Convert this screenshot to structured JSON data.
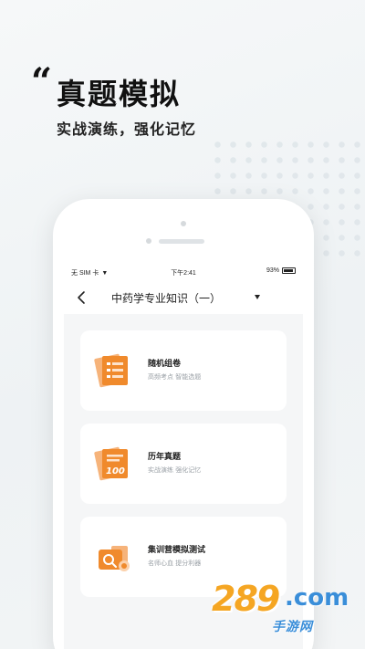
{
  "promo": {
    "quote_mark": "“",
    "headline": "真题模拟",
    "subheadline": "实战演练，强化记忆"
  },
  "status_bar": {
    "carrier": "无 SIM 卡",
    "time": "下午2:41",
    "battery": "93%"
  },
  "nav": {
    "back_icon": "chevron-left-icon",
    "title": "中药学专业知识（一）",
    "dropdown_icon": "caret-down-icon"
  },
  "cards": [
    {
      "title": "随机组卷",
      "subtitle": "高频考点 智能选题",
      "icon": "paper-list-icon"
    },
    {
      "title": "历年真题",
      "subtitle": "实战演练 强化记忆",
      "icon": "score-100-paper-icon"
    },
    {
      "title": "集训营模拟测试",
      "subtitle": "名师心血 提分利器",
      "icon": "camp-test-icon"
    }
  ],
  "watermark": {
    "number": "289",
    "suffix": ".com",
    "subtitle": "手游网"
  },
  "colors": {
    "accent_orange": "#f08a2c",
    "watermark_orange": "#f5a623",
    "watermark_blue": "#3a8ed9"
  }
}
